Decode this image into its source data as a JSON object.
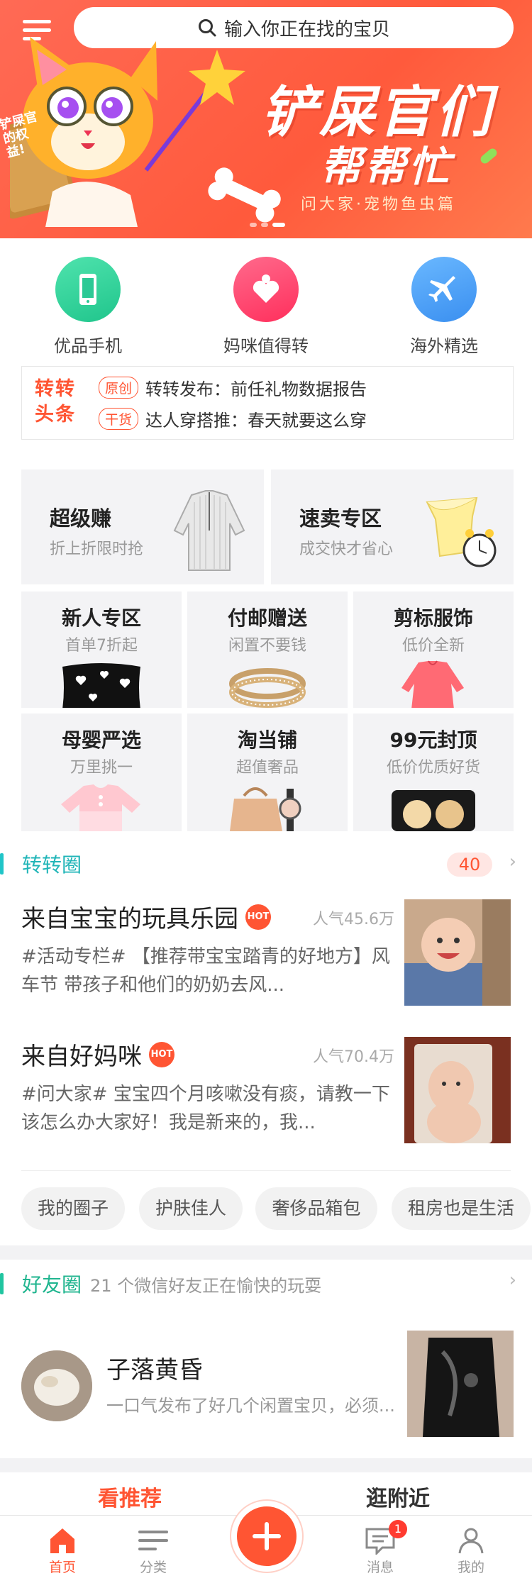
{
  "search": {
    "placeholder": "输入你正在找的宝贝"
  },
  "banner": {
    "title": "铲屎官们",
    "subtitle": "帮帮忙",
    "caption": "问大家·宠物鱼虫篇",
    "book_text": "铲屎官的权益!"
  },
  "quick_nav": [
    {
      "label": "优品手机",
      "icon": "phone-icon",
      "color": "#2fd39a"
    },
    {
      "label": "妈咪值得转",
      "icon": "mom-heart-icon",
      "color": "#ff3e6c"
    },
    {
      "label": "海外精选",
      "icon": "airplane-icon",
      "color": "#3f9cf5"
    }
  ],
  "news": {
    "logo_line1": "转转",
    "logo_line2": "头条",
    "items": [
      {
        "tag": "原创",
        "text": "转转发布：前任礼物数据报告"
      },
      {
        "tag": "干货",
        "text": "达人穿搭推：春天就要这么穿"
      }
    ]
  },
  "promos": {
    "large": [
      {
        "title": "超级赚",
        "subtitle": "折上折限时抢"
      },
      {
        "title": "速卖专区",
        "subtitle": "成交快才省心"
      }
    ],
    "small": [
      {
        "title": "新人专区",
        "subtitle": "首单7折起"
      },
      {
        "title": "付邮赠送",
        "subtitle": "闲置不要钱"
      },
      {
        "title": "剪标服饰",
        "subtitle": "低价全新"
      },
      {
        "title": "母婴严选",
        "subtitle": "万里挑一"
      },
      {
        "title": "淘当铺",
        "subtitle": "超值奢品"
      },
      {
        "title": "99元封顶",
        "subtitle": "低价优质好货"
      }
    ]
  },
  "circle": {
    "title": "转转圈",
    "count": "40",
    "posts": [
      {
        "title": "来自宝宝的玩具乐园",
        "hot": "HOT",
        "popularity": "人气45.6万",
        "desc": "#活动专栏# 【推荐带宝宝踏青的好地方】风车节 带孩子和他们的奶奶去风..."
      },
      {
        "title": "来自好妈咪",
        "hot": "HOT",
        "popularity": "人气70.4万",
        "desc": "#问大家# 宝宝四个月咳嗽没有痰，请教一下该怎么办大家好！我是新来的，我..."
      }
    ],
    "chips": [
      "我的圈子",
      "护肤佳人",
      "奢侈品箱包",
      "租房也是生活"
    ]
  },
  "friends": {
    "title": "好友圈",
    "subtitle": "21 个微信好友正在愉快的玩耍",
    "name": "子落黄昏",
    "desc": "一口气发布了好几个闲置宝贝，必须..."
  },
  "recommend": {
    "left": "看推荐",
    "right": "逛附近"
  },
  "tabbar": {
    "home": "首页",
    "category": "分类",
    "messages": "消息",
    "messages_badge": "1",
    "me": "我的"
  },
  "colors": {
    "brand": "#ff5533",
    "teal": "#20c5c8"
  }
}
